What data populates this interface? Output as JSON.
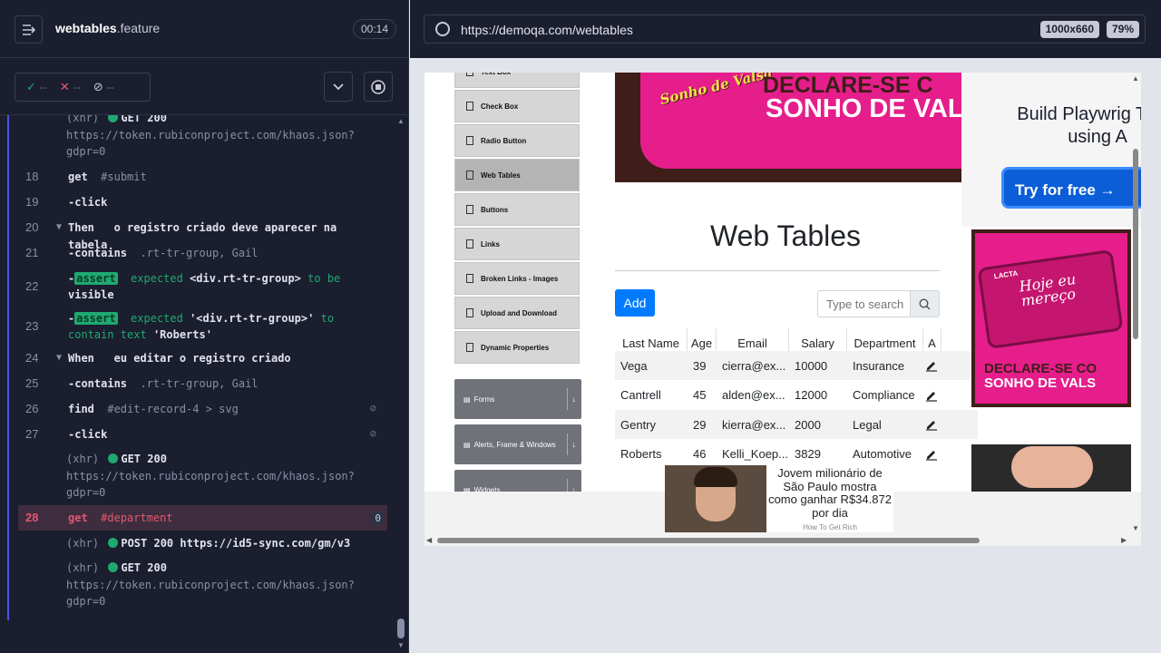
{
  "header": {
    "spec_name": "webtables",
    "spec_ext": ".feature",
    "timer": "00:14"
  },
  "stats": {
    "passed": "--",
    "failed": "--",
    "pending": "--"
  },
  "log": {
    "xhr1": {
      "prefix": "(xhr)",
      "status": "GET 200",
      "url": "https://token.rubiconproject.com/khaos.json?gdpr=0"
    },
    "r18": {
      "num": "18",
      "cmd": "get",
      "arg": "#submit"
    },
    "r19": {
      "num": "19",
      "cmd": "-click"
    },
    "r20": {
      "num": "20",
      "kw": "Then",
      "text": "o registro criado deve aparecer na tabela"
    },
    "r21": {
      "num": "21",
      "cmd": "-contains",
      "arg": ".rt-tr-group, Gail"
    },
    "r22": {
      "num": "22",
      "badge": "assert",
      "a": "expected",
      "b": "<div.rt-tr-group>",
      "c": "to be",
      "d": "visible"
    },
    "r23": {
      "num": "23",
      "badge": "assert",
      "a": "expected",
      "b": "'<div.rt-tr-group>'",
      "c": "to",
      "d": "contain text",
      "e": "'Roberts'"
    },
    "r24": {
      "num": "24",
      "kw": "When",
      "text": "eu editar o registro criado"
    },
    "r25": {
      "num": "25",
      "cmd": "-contains",
      "arg": ".rt-tr-group, Gail"
    },
    "r26": {
      "num": "26",
      "cmd": "find",
      "arg": "#edit-record-4 > svg"
    },
    "r27": {
      "num": "27",
      "cmd": "-click"
    },
    "xhr2": {
      "prefix": "(xhr)",
      "status": "GET 200",
      "url": "https://token.rubiconproject.com/khaos.json?gdpr=0"
    },
    "r28": {
      "num": "28",
      "cmd": "get",
      "arg": "#department",
      "count": "0"
    },
    "xhr3": {
      "prefix": "(xhr)",
      "status": "POST 200",
      "url": "https://id5-sync.com/gm/v3"
    },
    "xhr4": {
      "prefix": "(xhr)",
      "status": "GET 200",
      "url": "https://token.rubiconproject.com/khaos.json?gdpr=0"
    }
  },
  "browser": {
    "url": "https://demoqa.com/webtables",
    "viewport": "1000x660",
    "zoom": "79%"
  },
  "aut": {
    "sidebar": [
      "Text Box",
      "Check Box",
      "Radio Button",
      "Web Tables",
      "Buttons",
      "Links",
      "Broken Links - Images",
      "Upload and Download",
      "Dynamic Properties"
    ],
    "groups": [
      "Forms",
      "Alerts, Frame & Windows",
      "Widgets"
    ],
    "banner": {
      "logo": "Sonho de Valsa",
      "line1": "DECLARE-SE C",
      "line2": "SONHO DE VAL"
    },
    "title": "Web Tables",
    "add_label": "Add",
    "search_placeholder": "Type to search",
    "table": {
      "headers": [
        "Last Name",
        "Age",
        "Email",
        "Salary",
        "Department",
        "A"
      ],
      "rows": [
        [
          "Vega",
          "39",
          "cierra@ex...",
          "10000",
          "Insurance"
        ],
        [
          "Cantrell",
          "45",
          "alden@ex...",
          "12000",
          "Compliance"
        ],
        [
          "Gentry",
          "29",
          "kierra@ex...",
          "2000",
          "Legal"
        ],
        [
          "Roberts",
          "46",
          "Kelli_Koep...",
          "3829",
          "Automotive"
        ]
      ]
    },
    "ad_cypress": {
      "heading": "Build Playwrig Tests using A",
      "button": "Try for free →"
    },
    "ad_candy": {
      "brand": "LACTA",
      "text": "Hoje eu mereço",
      "line1": "DECLARE-SE CO",
      "line2": "SONHO DE VALS"
    },
    "ad_popup": {
      "text": "Jovem milionário de São Paulo mostra como ganhar R$34.872 por dia",
      "source": "How To Get Rich"
    }
  },
  "colors": {
    "active_row": "#3d2d3e",
    "accent_blue": "#007bff",
    "pass_green": "#1fa971",
    "log_border": "#4956e3"
  }
}
